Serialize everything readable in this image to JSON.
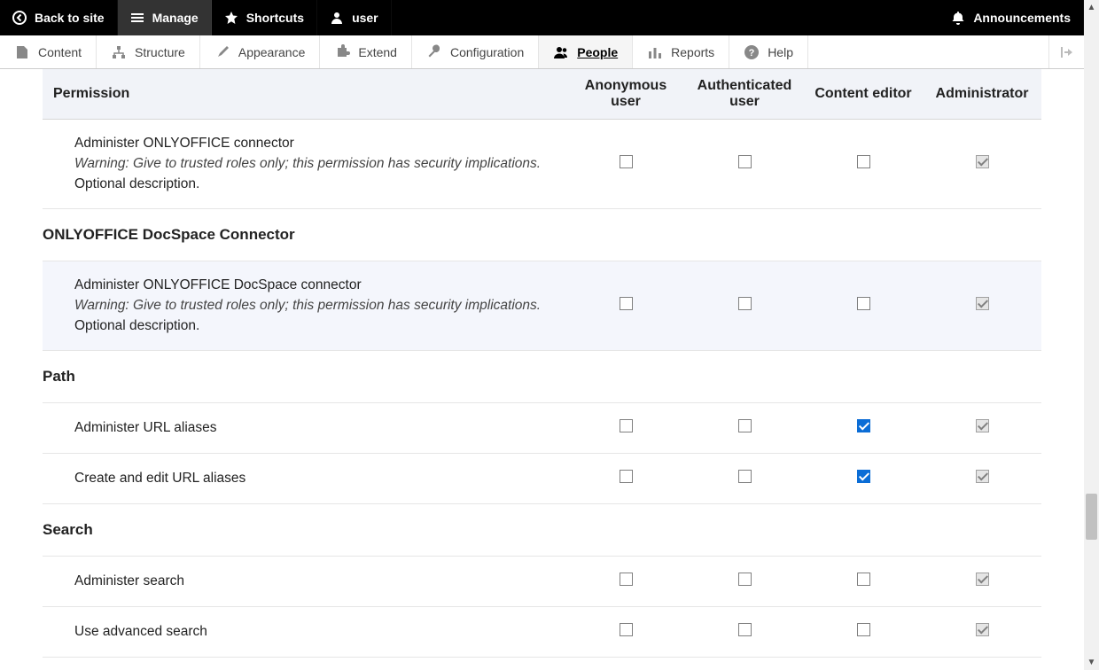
{
  "toolbar": {
    "back": "Back to site",
    "manage": "Manage",
    "shortcuts": "Shortcuts",
    "user": "user",
    "announcements": "Announcements"
  },
  "menubar": {
    "content": "Content",
    "structure": "Structure",
    "appearance": "Appearance",
    "extend": "Extend",
    "configuration": "Configuration",
    "people": "People",
    "reports": "Reports",
    "help": "Help"
  },
  "columns": {
    "permission": "Permission",
    "anonymous": "Anonymous user",
    "authenticated": "Authenticated user",
    "content_editor": "Content editor",
    "administrator": "Administrator"
  },
  "sections": [
    {
      "rows": [
        {
          "title": "Administer ONLYOFFICE connector",
          "warning": "Warning: Give to trusted roles only; this permission has security implications.",
          "optional": "Optional description.",
          "checks": {
            "anon": false,
            "auth": false,
            "editor": false,
            "admin": "locked"
          }
        }
      ]
    },
    {
      "name": "ONLYOFFICE DocSpace Connector",
      "rows": [
        {
          "title": "Administer ONLYOFFICE DocSpace connector",
          "warning": "Warning: Give to trusted roles only; this permission has security implications.",
          "optional": "Optional description.",
          "hover": true,
          "checks": {
            "anon": false,
            "auth": false,
            "editor": false,
            "admin": "locked"
          }
        }
      ]
    },
    {
      "name": "Path",
      "rows": [
        {
          "title": "Administer URL aliases",
          "checks": {
            "anon": false,
            "auth": false,
            "editor": true,
            "admin": "locked"
          }
        },
        {
          "title": "Create and edit URL aliases",
          "checks": {
            "anon": false,
            "auth": false,
            "editor": true,
            "admin": "locked"
          }
        }
      ]
    },
    {
      "name": "Search",
      "rows": [
        {
          "title": "Administer search",
          "checks": {
            "anon": false,
            "auth": false,
            "editor": false,
            "admin": "locked"
          }
        },
        {
          "title": "Use advanced search",
          "checks": {
            "anon": false,
            "auth": false,
            "editor": false,
            "admin": "locked"
          }
        }
      ]
    }
  ]
}
